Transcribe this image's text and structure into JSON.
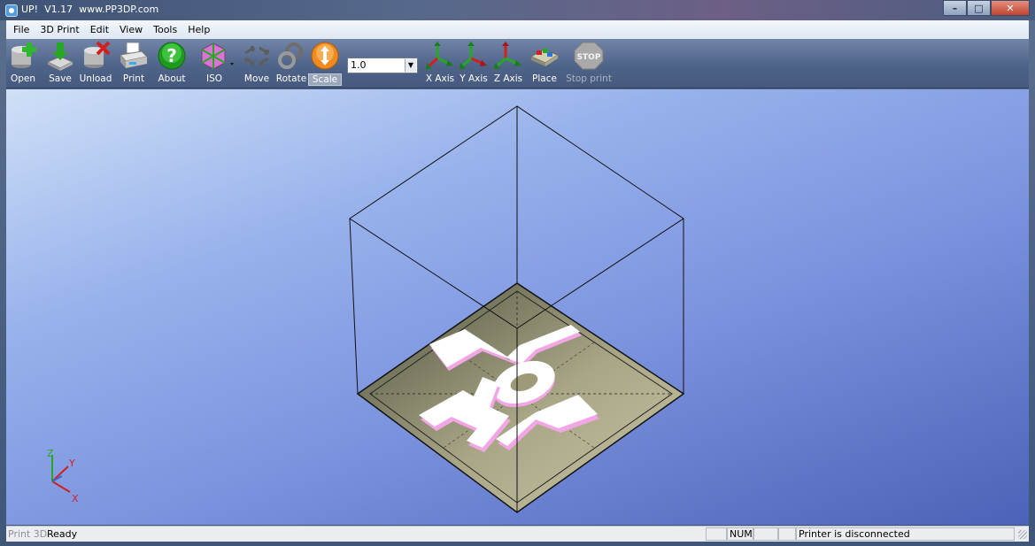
{
  "window": {
    "title": "UP!  V1.17  www.PP3DP.com",
    "controls": [
      "minimize-button",
      "maximize-button",
      "close-button"
    ]
  },
  "menu": [
    "File",
    "3D Print",
    "Edit",
    "View",
    "Tools",
    "Help"
  ],
  "toolbar": {
    "open": "Open",
    "save": "Save",
    "unload": "Unload",
    "print": "Print",
    "about": "About",
    "iso": "ISO",
    "move": "Move",
    "rotate": "Rotate",
    "scale": "Scale",
    "scale_value": "1.0",
    "x_axis": "X Axis",
    "y_axis": "Y Axis",
    "z_axis": "Z Axis",
    "place": "Place",
    "stop_print": "Stop print",
    "stop_badge": "STOP"
  },
  "viewport": {
    "model_text": "LOL",
    "axis_labels": {
      "z": "Z",
      "y": "Y",
      "x": "X"
    },
    "colors": {
      "model_top": "#ffffff",
      "model_side": "#f2a6e6",
      "bed": "#9e9a78"
    }
  },
  "status": {
    "panel_name": "Print 3D",
    "message": "Ready",
    "num": "NUM",
    "printer": "Printer is disconnected"
  }
}
